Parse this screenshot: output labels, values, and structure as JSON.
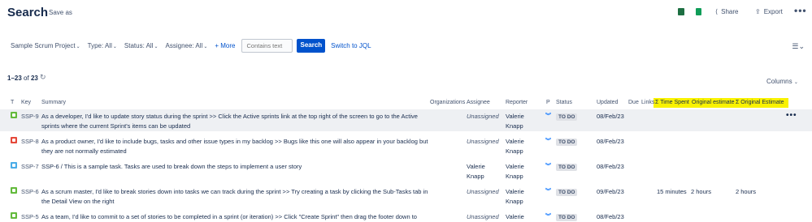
{
  "header": {
    "title": "Search",
    "save_as": "Save as",
    "share": "Share",
    "export": "Export"
  },
  "filters": {
    "project": "Sample Scrum Project",
    "type": "Type: All",
    "status": "Status: All",
    "assignee": "Assignee: All",
    "more": "+ More",
    "contains_placeholder": "Contains text",
    "search": "Search",
    "switch_jql": "Switch to JQL"
  },
  "results": {
    "count_range": "1–23",
    "count_of": "of",
    "count_total": "23",
    "columns": "Columns"
  },
  "table": {
    "headers": {
      "t": "T",
      "key": "Key",
      "summary": "Summary",
      "organizations": "Organizations",
      "assignee": "Assignee",
      "reporter": "Reporter",
      "p": "P",
      "status": "Status",
      "updated": "Updated",
      "due": "Due",
      "links": "Links",
      "time_spent": "Σ Time Spent",
      "original_estimate": "Original estimate",
      "sum_original_estimate": "Σ Original Estimate"
    },
    "rows": [
      {
        "type": "story",
        "key": "SSP-9",
        "summary": "As a developer, I'd like to update story status during the sprint >> Click the Active sprints link at the top right of the screen to go to the Active sprints where the current Sprint's items can be updated",
        "assignee": "Unassigned",
        "reporter": "Valerie Knapp",
        "status": "TO DO",
        "updated": "08/Feb/23",
        "time_spent": "",
        "original_estimate": "",
        "sum_original_estimate": ""
      },
      {
        "type": "bug",
        "key": "SSP-8",
        "summary": "As a product owner, I'd like to include bugs, tasks and other issue types in my backlog >> Bugs like this one will also appear in your backlog but they are not normally estimated",
        "assignee": "Unassigned",
        "reporter": "Valerie Knapp",
        "status": "TO DO",
        "updated": "08/Feb/23",
        "time_spent": "",
        "original_estimate": "",
        "sum_original_estimate": ""
      },
      {
        "type": "task",
        "key": "SSP-7",
        "summary": "SSP-6 / This is a sample task. Tasks are used to break down the steps to implement a user story",
        "assignee": "Valerie Knapp",
        "reporter": "Valerie Knapp",
        "status": "TO DO",
        "updated": "08/Feb/23",
        "time_spent": "",
        "original_estimate": "",
        "sum_original_estimate": ""
      },
      {
        "type": "story",
        "key": "SSP-6",
        "summary": "As a scrum master, I'd like to break stories down into tasks we can track during the sprint >> Try creating a task by clicking the Sub-Tasks tab in the Detail View on the right",
        "assignee": "Unassigned",
        "reporter": "Valerie Knapp",
        "status": "TO DO",
        "updated": "09/Feb/23",
        "time_spent": "15 minutes",
        "original_estimate": "2 hours",
        "sum_original_estimate": "2 hours"
      },
      {
        "type": "story",
        "key": "SSP-5",
        "summary": "As a team, I'd like to commit to a set of stories to be completed in a sprint (or iteration) >> Click \"Create Sprint\" then drag the footer down to select issues for a sprint (you can't start a sprint at the moment because one is already active)",
        "assignee": "Unassigned",
        "reporter": "Valerie Knapp",
        "status": "TO DO",
        "updated": "08/Feb/23",
        "time_spent": "",
        "original_estimate": "",
        "sum_original_estimate": ""
      }
    ]
  },
  "colors": {
    "highlight": "#f9f200",
    "link": "#0052cc",
    "story": "#63ba3c",
    "bug": "#e5493a",
    "task": "#4bade8"
  }
}
